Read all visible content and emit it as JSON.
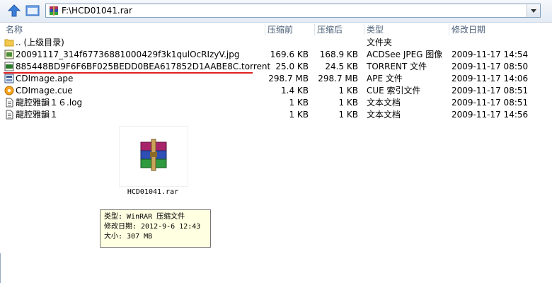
{
  "address": {
    "path": "F:\\HCD01041.rar"
  },
  "columns": {
    "name": "名称",
    "packed": "压缩前",
    "size": "压缩后",
    "type": "类型",
    "modified": "修改日期"
  },
  "files": [
    {
      "name": ".. (上级目录)",
      "packed": "",
      "size": "",
      "type": "文件夹",
      "modified": "",
      "icon": "folder-icon"
    },
    {
      "name": "20091117_314f67736881000429f3k1qulOcRIzyV.jpg",
      "packed": "169.6 KB",
      "size": "168.9 KB",
      "type": "ACDSee JPEG 图像",
      "modified": "2009-11-17 14:54",
      "icon": "jpeg-file-icon"
    },
    {
      "name": "885448BD9F6F6BF025BEDD0BEA617852D1AABE8C.torrent",
      "packed": "25.0 KB",
      "size": "24.5 KB",
      "type": "TORRENT 文件",
      "modified": "2009-11-17 08:50",
      "icon": "torrent-file-icon"
    },
    {
      "name": "CDImage.ape",
      "packed": "298.7 MB",
      "size": "298.7 MB",
      "type": "APE 文件",
      "modified": "2009-11-17 14:06",
      "icon": "ape-file-icon"
    },
    {
      "name": "CDImage.cue",
      "packed": "1.4 KB",
      "size": "1 KB",
      "type": "CUE 索引文件",
      "modified": "2009-11-17 08:51",
      "icon": "cue-file-icon"
    },
    {
      "name": "龍腔雅韻１６.log",
      "packed": "1 KB",
      "size": "1 KB",
      "type": "文本文档",
      "modified": "2009-11-17 08:51",
      "icon": "text-file-icon"
    },
    {
      "name": "龍腔雅韻１",
      "packed": "1 KB",
      "size": "1 KB",
      "type": "文本文档",
      "modified": "2009-11-17 14:56",
      "icon": "text-file-icon"
    }
  ],
  "preview": {
    "filename": "HCD01041.rar"
  },
  "tooltip": {
    "type_line": "类型: WinRAR 压缩文件",
    "date_line": "修改日期: 2012-9-6 12:43",
    "size_line": "大小: 307 MB"
  },
  "colors": {
    "highlight_underline": "#e02020",
    "tooltip_bg": "#ffffe1"
  }
}
